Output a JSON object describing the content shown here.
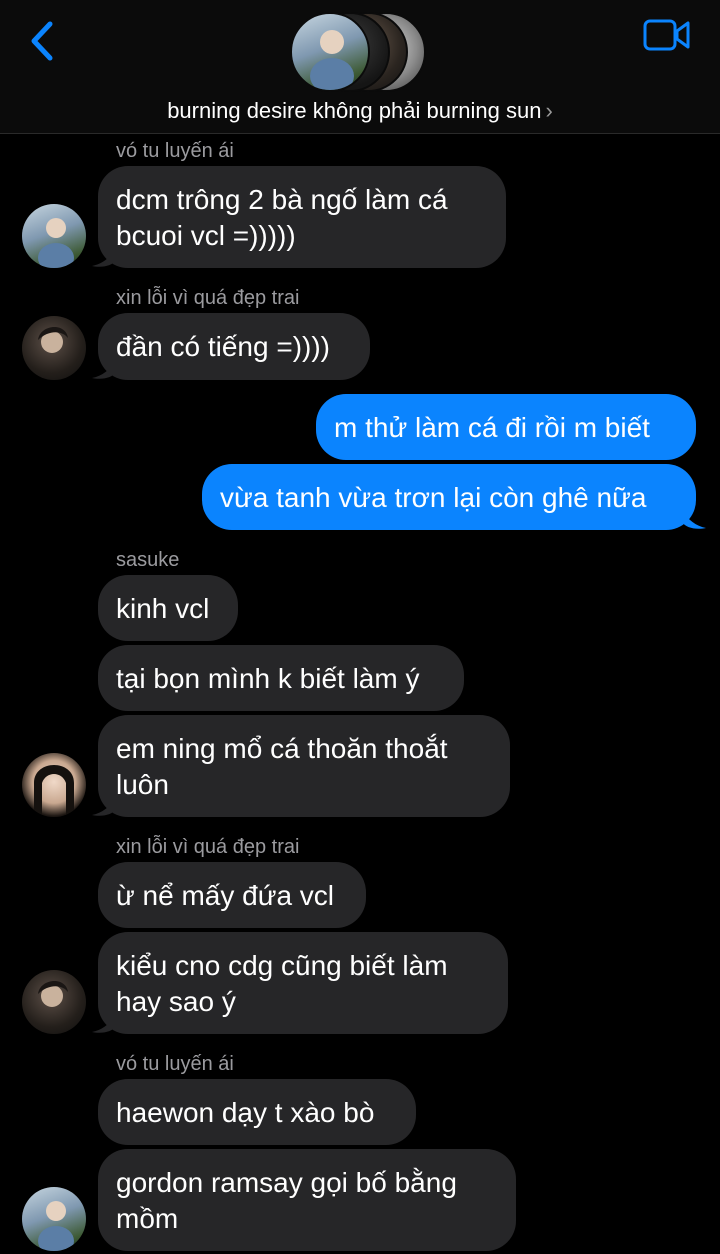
{
  "header": {
    "title": "burning desire không phải burning sun",
    "chevron": "›",
    "back_icon": "chevron-left-icon",
    "video_icon": "video-call-icon",
    "accent": "#0b84fe"
  },
  "messages": [
    {
      "sender": "vó tu luyến ái",
      "lines": [
        "dcm trông 2 bà ngố làm cá",
        "bcuoi vcl =)))))"
      ]
    },
    {
      "sender": "xin lỗi vì quá đẹp trai",
      "lines": [
        "đần có tiếng =))))"
      ]
    },
    {
      "out": [
        "m thử làm cá đi rồi m biết",
        "vừa tanh vừa trơn lại còn ghê nữa"
      ]
    },
    {
      "sender": "sasuke",
      "lines": [
        "kinh vcl",
        "tại bọn mình k biết làm ý",
        "em ning mổ cá thoăn thoắt",
        "luôn"
      ]
    },
    {
      "sender": "xin lỗi vì quá đẹp trai",
      "lines": [
        "ừ nể mấy đứa vcl",
        "kiểu cno cdg cũng biết làm",
        "hay sao ý"
      ]
    },
    {
      "sender": "vó tu luyến ái",
      "lines": [
        "haewon dạy t xào bò",
        "gordon ramsay gọi bố bằng",
        "mồm"
      ]
    }
  ],
  "colors": {
    "background": "#000000",
    "incoming_bubble": "#262628",
    "outgoing_bubble": "#0b84fe",
    "sender_name": "#9b9b9f"
  }
}
